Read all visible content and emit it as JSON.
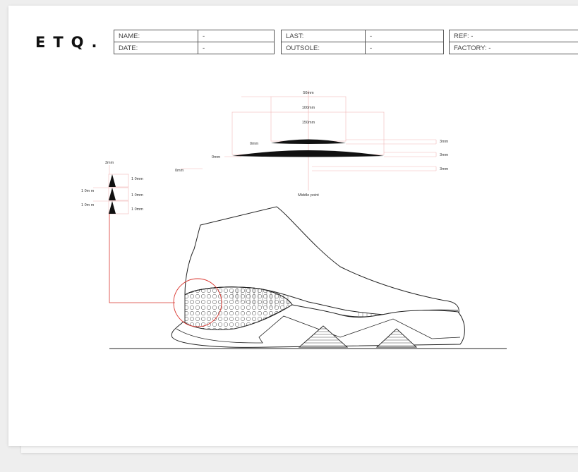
{
  "logo": "ETQ.",
  "spec_table_1": {
    "rows": [
      {
        "label": "NAME:",
        "value": "-"
      },
      {
        "label": "DATE:",
        "value": "-"
      }
    ]
  },
  "spec_table_2": {
    "rows": [
      {
        "label": "LAST:",
        "value": "-"
      },
      {
        "label": "OUTSOLE:",
        "value": "-"
      }
    ]
  },
  "spec_table_3": {
    "rows": [
      {
        "label": "REF: -"
      },
      {
        "label": "FACTORY: -"
      }
    ]
  },
  "top_diagram": {
    "widths": [
      "50mm",
      "100mm",
      "150mm"
    ],
    "left_heights": [
      "0mm",
      "0mm",
      "0mm"
    ],
    "right_heights": [
      "3mm",
      "3mm",
      "3mm"
    ],
    "middle_label": "Middle point"
  },
  "side_diagram": {
    "top_label": "3mm",
    "right_labels": [
      "1 0mm",
      "1 0mm",
      "1 0mm"
    ],
    "left_labels": [
      "1 0m m",
      "1 0m m"
    ]
  },
  "colors": {
    "accent_red": "#d9362f",
    "guide_pink": "#f2b8b8",
    "line": "#222222",
    "hatch": "#bdbdbd"
  }
}
